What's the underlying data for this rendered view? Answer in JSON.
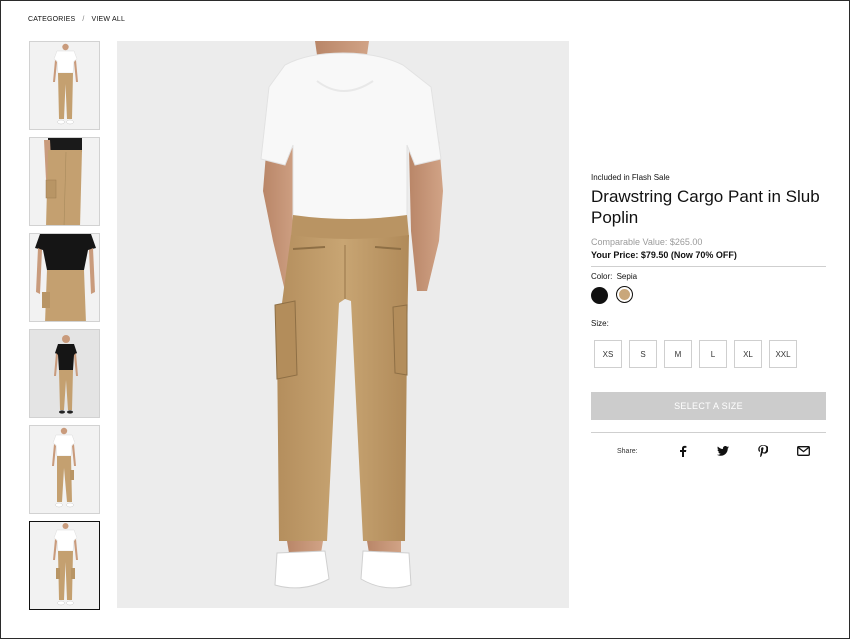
{
  "breadcrumb": {
    "categories": "CATEGORIES",
    "separator": "/",
    "view_all": "VIEW ALL"
  },
  "gallery": {
    "thumbnail_count": 6,
    "active_index": 5,
    "main_image": "model-back-view-cargo-pant"
  },
  "product": {
    "flash_sale_label": "Included in Flash Sale",
    "title": "Drawstring Cargo Pant in Slub Poplin",
    "comparable_value": "Comparable Value: $265.00",
    "your_price": "Your Price: $79.50 (Now 70% OFF)",
    "color_label": "Color:",
    "color_selected": "Sepia",
    "swatches": [
      {
        "name": "black",
        "hex": "#111111"
      },
      {
        "name": "sepia",
        "hex": "#c9a77b"
      }
    ],
    "size_label": "Size:",
    "sizes": [
      "XS",
      "S",
      "M",
      "L",
      "XL",
      "XXL"
    ],
    "select_size_button": "SELECT A SIZE"
  },
  "share": {
    "label": "Share:",
    "icons": [
      "facebook-icon",
      "twitter-icon",
      "pinterest-icon",
      "email-icon"
    ]
  },
  "colors": {
    "pant_khaki": "#c4a070",
    "tee_white": "#f7f7f7",
    "skin": "#c99b7c",
    "button_disabled": "#cccccc"
  }
}
